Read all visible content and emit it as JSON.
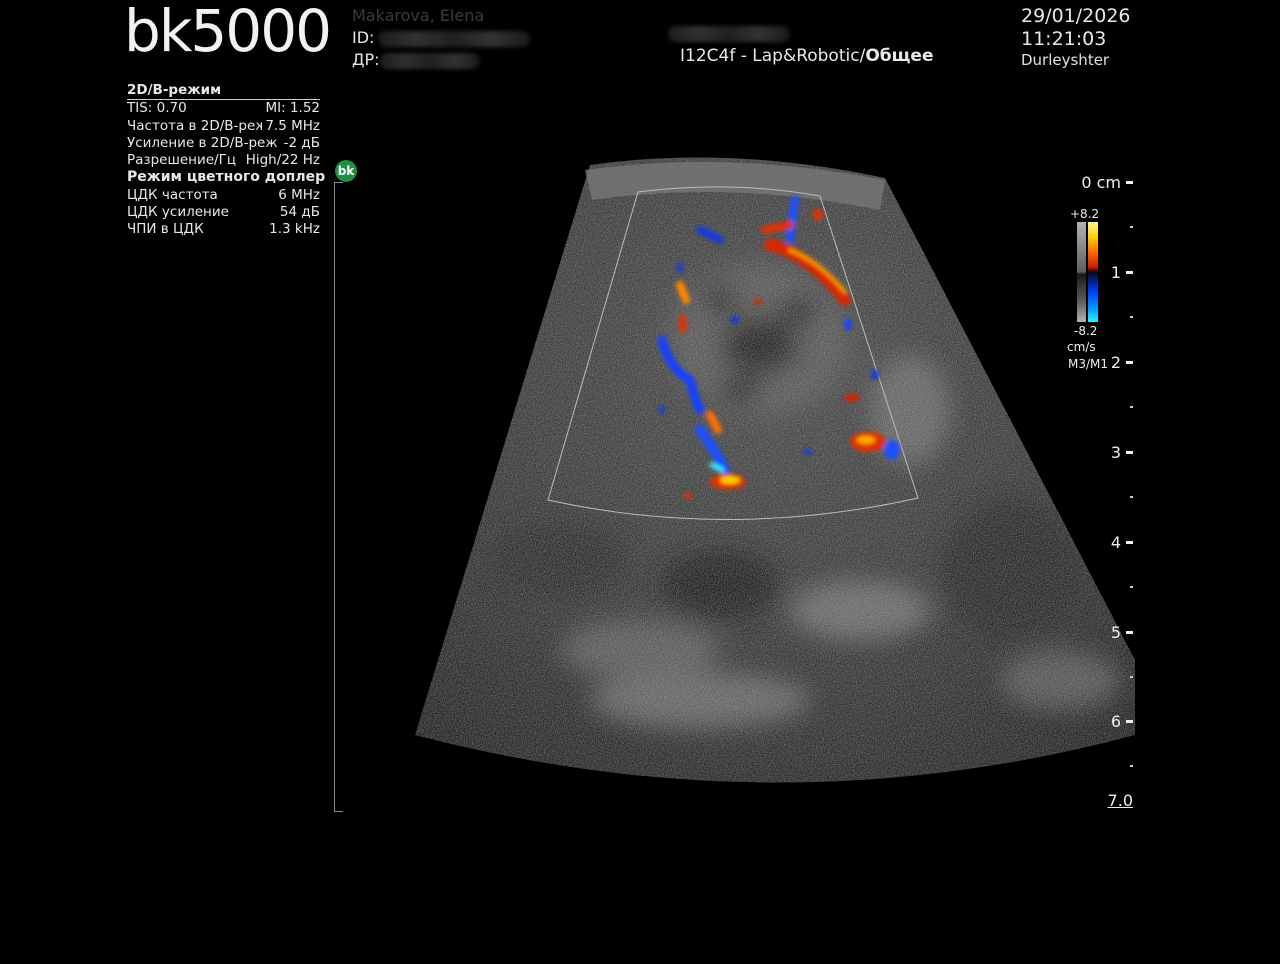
{
  "header": {
    "logo": "bk5000",
    "patient_name": "Makarova, Elena",
    "id_label": "ID:",
    "dob_label": "ДР:",
    "probe_prefix": "I12C4f - Lap&Robotic/",
    "probe_preset": "Общее",
    "date": "29/01/2026",
    "time": "11:21:03",
    "user": "Durleyshter"
  },
  "params": {
    "mode_2d_title": "2D/B-режим",
    "tis": "TIS: 0.70",
    "mi": "MI: 1.52",
    "rows_2d": [
      {
        "label": "Частота в 2D/B-реж",
        "value": "7.5 MHz"
      },
      {
        "label": "Усиление в 2D/B-реж",
        "value": "-2  дБ"
      },
      {
        "label": "Разрешение/Гц",
        "value": "High/22 Hz"
      }
    ],
    "color_title": "Режим цветного доплер",
    "rows_color": [
      {
        "label": "ЦДК частота",
        "value": "6 MHz"
      },
      {
        "label": "ЦДК усиление",
        "value": "54  дБ"
      },
      {
        "label": "ЧПИ в ЦДК",
        "value": "1.3 kHz"
      }
    ]
  },
  "badge": "bk",
  "depth_scale": {
    "unit_label": "0 cm",
    "labels": [
      "1",
      "2",
      "3",
      "4",
      "5",
      "6",
      "7.0"
    ]
  },
  "color_bar": {
    "max": "+8.2",
    "min": "-8.2",
    "unit": "cm/s",
    "map": "M3/M1"
  },
  "colors": {
    "background": "#000000",
    "badge": "#1e8f3e",
    "doppler_red": "#e03000",
    "doppler_blue": "#1840ff"
  }
}
